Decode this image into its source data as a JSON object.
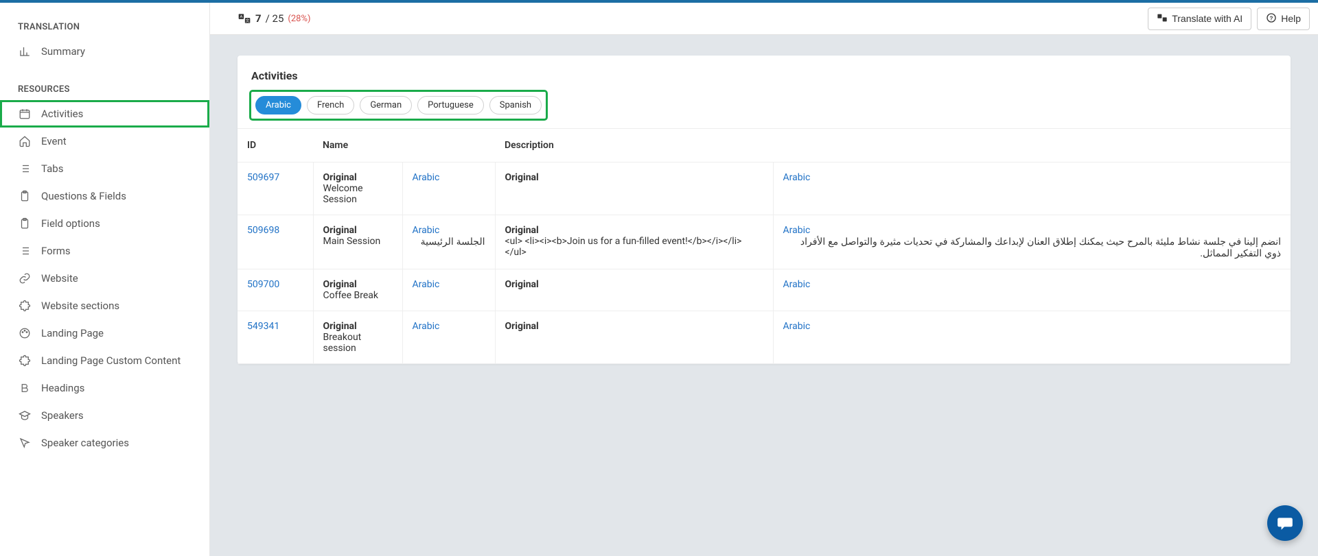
{
  "sidebar": {
    "sections": [
      {
        "title": "TRANSLATION",
        "items": [
          {
            "label": "Summary",
            "icon": "bar-chart-icon",
            "highlighted": false
          }
        ]
      },
      {
        "title": "RESOURCES",
        "items": [
          {
            "label": "Activities",
            "icon": "calendar-icon",
            "highlighted": true
          },
          {
            "label": "Event",
            "icon": "home-icon",
            "highlighted": false
          },
          {
            "label": "Tabs",
            "icon": "list-icon",
            "highlighted": false
          },
          {
            "label": "Questions & Fields",
            "icon": "clipboard-icon",
            "highlighted": false
          },
          {
            "label": "Field options",
            "icon": "clipboard-icon",
            "highlighted": false
          },
          {
            "label": "Forms",
            "icon": "list-icon",
            "highlighted": false
          },
          {
            "label": "Website",
            "icon": "link-icon",
            "highlighted": false
          },
          {
            "label": "Website sections",
            "icon": "puzzle-icon",
            "highlighted": false
          },
          {
            "label": "Landing Page",
            "icon": "palette-icon",
            "highlighted": false
          },
          {
            "label": "Landing Page Custom Content",
            "icon": "puzzle-icon",
            "highlighted": false
          },
          {
            "label": "Headings",
            "icon": "bold-icon",
            "highlighted": false
          },
          {
            "label": "Speakers",
            "icon": "graduation-icon",
            "highlighted": false
          },
          {
            "label": "Speaker categories",
            "icon": "cursor-icon",
            "highlighted": false
          }
        ]
      }
    ]
  },
  "topbar": {
    "progress_current": "7",
    "progress_total": "/ 25",
    "progress_pct": "(28%)",
    "translate_btn": "Translate with AI",
    "help_btn": "Help"
  },
  "card": {
    "title": "Activities",
    "languages": [
      {
        "label": "Arabic",
        "active": true
      },
      {
        "label": "French",
        "active": false
      },
      {
        "label": "German",
        "active": false
      },
      {
        "label": "Portuguese",
        "active": false
      },
      {
        "label": "Spanish",
        "active": false
      }
    ]
  },
  "table": {
    "headers": {
      "id": "ID",
      "name": "Name",
      "description": "Description"
    },
    "original_label": "Original",
    "lang_label": "Arabic",
    "rows": [
      {
        "id": "509697",
        "name_original": "Welcome Session",
        "name_translated": "",
        "desc_original": "",
        "desc_translated": ""
      },
      {
        "id": "509698",
        "name_original": "Main Session",
        "name_translated": "الجلسة الرئيسية",
        "desc_original": "<ul> <li><i><b>Join us for a fun-filled event!</b></i></li> </ul>",
        "desc_translated": "انضم إلينا في جلسة نشاط مليئة بالمرح حيث يمكنك إطلاق العنان لإبداعك والمشاركة في تحديات مثيرة والتواصل مع الأفراد ذوي التفكير المماثل."
      },
      {
        "id": "509700",
        "name_original": "Coffee Break",
        "name_translated": "",
        "desc_original": "",
        "desc_translated": ""
      },
      {
        "id": "549341",
        "name_original": "Breakout session",
        "name_translated": "",
        "desc_original": "",
        "desc_translated": ""
      }
    ]
  }
}
